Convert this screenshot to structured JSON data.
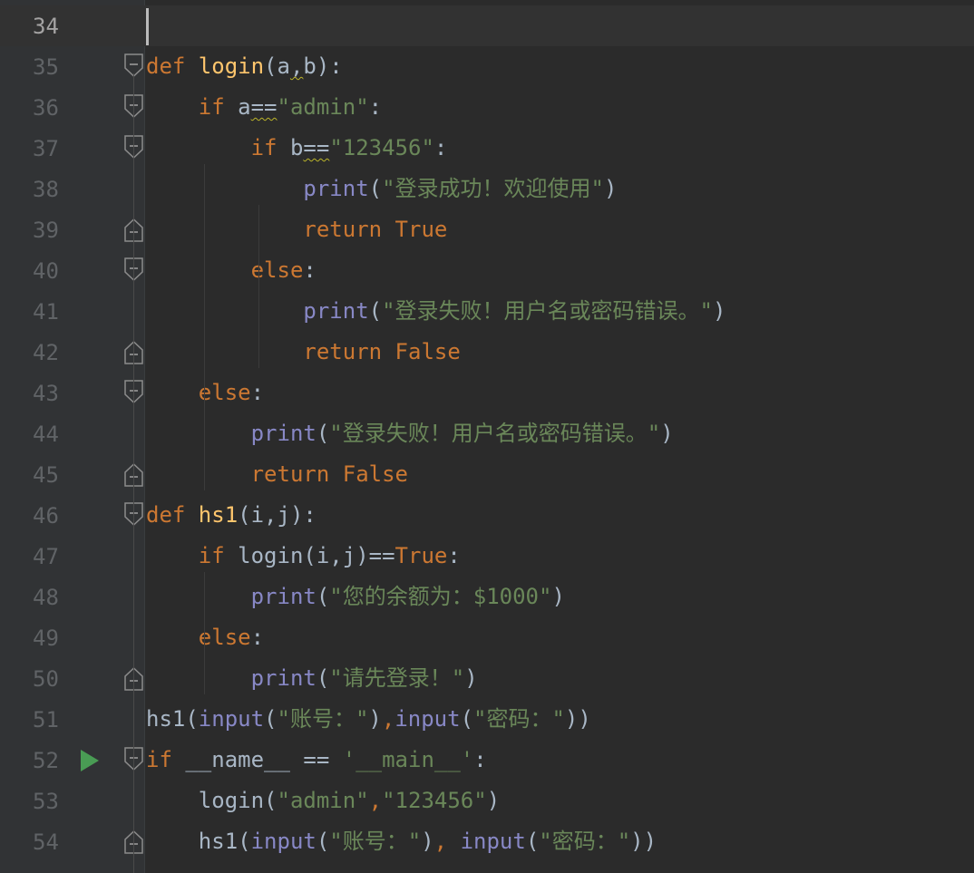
{
  "editor": {
    "lines": [
      {
        "n": "34",
        "t": []
      },
      {
        "n": "35",
        "t": [
          [
            "def ",
            "kw"
          ],
          [
            "login",
            "fn"
          ],
          [
            "(a",
            "pl"
          ],
          [
            ",",
            "warn"
          ],
          [
            "b):",
            "pl"
          ]
        ]
      },
      {
        "n": "36",
        "t": [
          [
            "    if ",
            "kw"
          ],
          [
            "a",
            "pl"
          ],
          [
            "==",
            "warn"
          ],
          [
            "\"admin\"",
            "str"
          ],
          [
            ":",
            "pl"
          ]
        ]
      },
      {
        "n": "37",
        "t": [
          [
            "        if ",
            "kw"
          ],
          [
            "b",
            "pl"
          ],
          [
            "==",
            "warn"
          ],
          [
            "\"123456\"",
            "str"
          ],
          [
            ":",
            "pl"
          ]
        ]
      },
      {
        "n": "38",
        "t": [
          [
            "            ",
            "pl"
          ],
          [
            "print",
            "bi"
          ],
          [
            "(",
            "pl"
          ],
          [
            "\"登录成功！欢迎使用\"",
            "str"
          ],
          [
            ")",
            "pl"
          ]
        ]
      },
      {
        "n": "39",
        "t": [
          [
            "            return ",
            "kw"
          ],
          [
            "True",
            "kw"
          ]
        ]
      },
      {
        "n": "40",
        "t": [
          [
            "        else",
            "kw"
          ],
          [
            ":",
            "pl"
          ]
        ]
      },
      {
        "n": "41",
        "t": [
          [
            "            ",
            "pl"
          ],
          [
            "print",
            "bi"
          ],
          [
            "(",
            "pl"
          ],
          [
            "\"登录失败！用户名或密码错误。\"",
            "str"
          ],
          [
            ")",
            "pl"
          ]
        ]
      },
      {
        "n": "42",
        "t": [
          [
            "            return ",
            "kw"
          ],
          [
            "False",
            "kw"
          ]
        ]
      },
      {
        "n": "43",
        "t": [
          [
            "    else",
            "kw"
          ],
          [
            ":",
            "pl"
          ]
        ]
      },
      {
        "n": "44",
        "t": [
          [
            "        ",
            "pl"
          ],
          [
            "print",
            "bi"
          ],
          [
            "(",
            "pl"
          ],
          [
            "\"登录失败！用户名或密码错误。\"",
            "str"
          ],
          [
            ")",
            "pl"
          ]
        ]
      },
      {
        "n": "45",
        "t": [
          [
            "        return ",
            "kw"
          ],
          [
            "False",
            "kw"
          ]
        ]
      },
      {
        "n": "46",
        "t": [
          [
            "def ",
            "kw"
          ],
          [
            "hs1",
            "fn"
          ],
          [
            "(i,j):",
            "pl"
          ]
        ]
      },
      {
        "n": "47",
        "t": [
          [
            "    if ",
            "kw"
          ],
          [
            "login(i,j)==",
            "pl"
          ],
          [
            "True",
            "kw"
          ],
          [
            ":",
            "pl"
          ]
        ]
      },
      {
        "n": "48",
        "t": [
          [
            "        ",
            "pl"
          ],
          [
            "print",
            "bi"
          ],
          [
            "(",
            "pl"
          ],
          [
            "\"您的余额为：$1000\"",
            "str"
          ],
          [
            ")",
            "pl"
          ]
        ]
      },
      {
        "n": "49",
        "t": [
          [
            "    else",
            "kw"
          ],
          [
            ":",
            "pl"
          ]
        ]
      },
      {
        "n": "50",
        "t": [
          [
            "        ",
            "pl"
          ],
          [
            "print",
            "bi"
          ],
          [
            "(",
            "pl"
          ],
          [
            "\"请先登录！\"",
            "str"
          ],
          [
            ")",
            "pl"
          ]
        ]
      },
      {
        "n": "51",
        "t": [
          [
            "hs1(",
            "pl"
          ],
          [
            "input",
            "bi"
          ],
          [
            "(",
            "pl"
          ],
          [
            "\"账号：\"",
            "str"
          ],
          [
            ")",
            "pl"
          ],
          [
            ",",
            "kw"
          ],
          [
            "input",
            "bi"
          ],
          [
            "(",
            "pl"
          ],
          [
            "\"密码：\"",
            "str"
          ],
          [
            "))",
            "pl"
          ]
        ]
      },
      {
        "n": "52",
        "t": [
          [
            "if ",
            "kw"
          ],
          [
            "__name__ == ",
            "pl"
          ],
          [
            "'__main__'",
            "str"
          ],
          [
            ":",
            "pl"
          ]
        ]
      },
      {
        "n": "53",
        "t": [
          [
            "    login(",
            "pl"
          ],
          [
            "\"admin\"",
            "str"
          ],
          [
            ",",
            "kw"
          ],
          [
            "\"123456\"",
            "str"
          ],
          [
            ")",
            "pl"
          ]
        ]
      },
      {
        "n": "54",
        "t": [
          [
            "    hs1(",
            "pl"
          ],
          [
            "input",
            "bi"
          ],
          [
            "(",
            "pl"
          ],
          [
            "\"账号：\"",
            "str"
          ],
          [
            ")",
            "pl"
          ],
          [
            ", ",
            "kw"
          ],
          [
            "input",
            "bi"
          ],
          [
            "(",
            "pl"
          ],
          [
            "\"密码：\"",
            "str"
          ],
          [
            "))",
            "pl"
          ]
        ]
      }
    ]
  },
  "gutter": {
    "folds": {
      "35": "open",
      "36": "open",
      "37": "open",
      "39": "close",
      "40": "open",
      "42": "close",
      "43": "open",
      "45": "close",
      "46": "open",
      "50": "close",
      "52": "open",
      "54": "close"
    },
    "run_line": "52",
    "run_icon": "run-triangle-icon",
    "current_line": "34"
  },
  "colors": {
    "background": "#2b2b2b",
    "gutter": "#313335",
    "keyword": "#cc7832",
    "function": "#ffc66d",
    "string": "#6a8759",
    "builtin": "#8888c6",
    "plain": "#a9b7c6",
    "line_number": "#606366",
    "run": "#499c54"
  }
}
